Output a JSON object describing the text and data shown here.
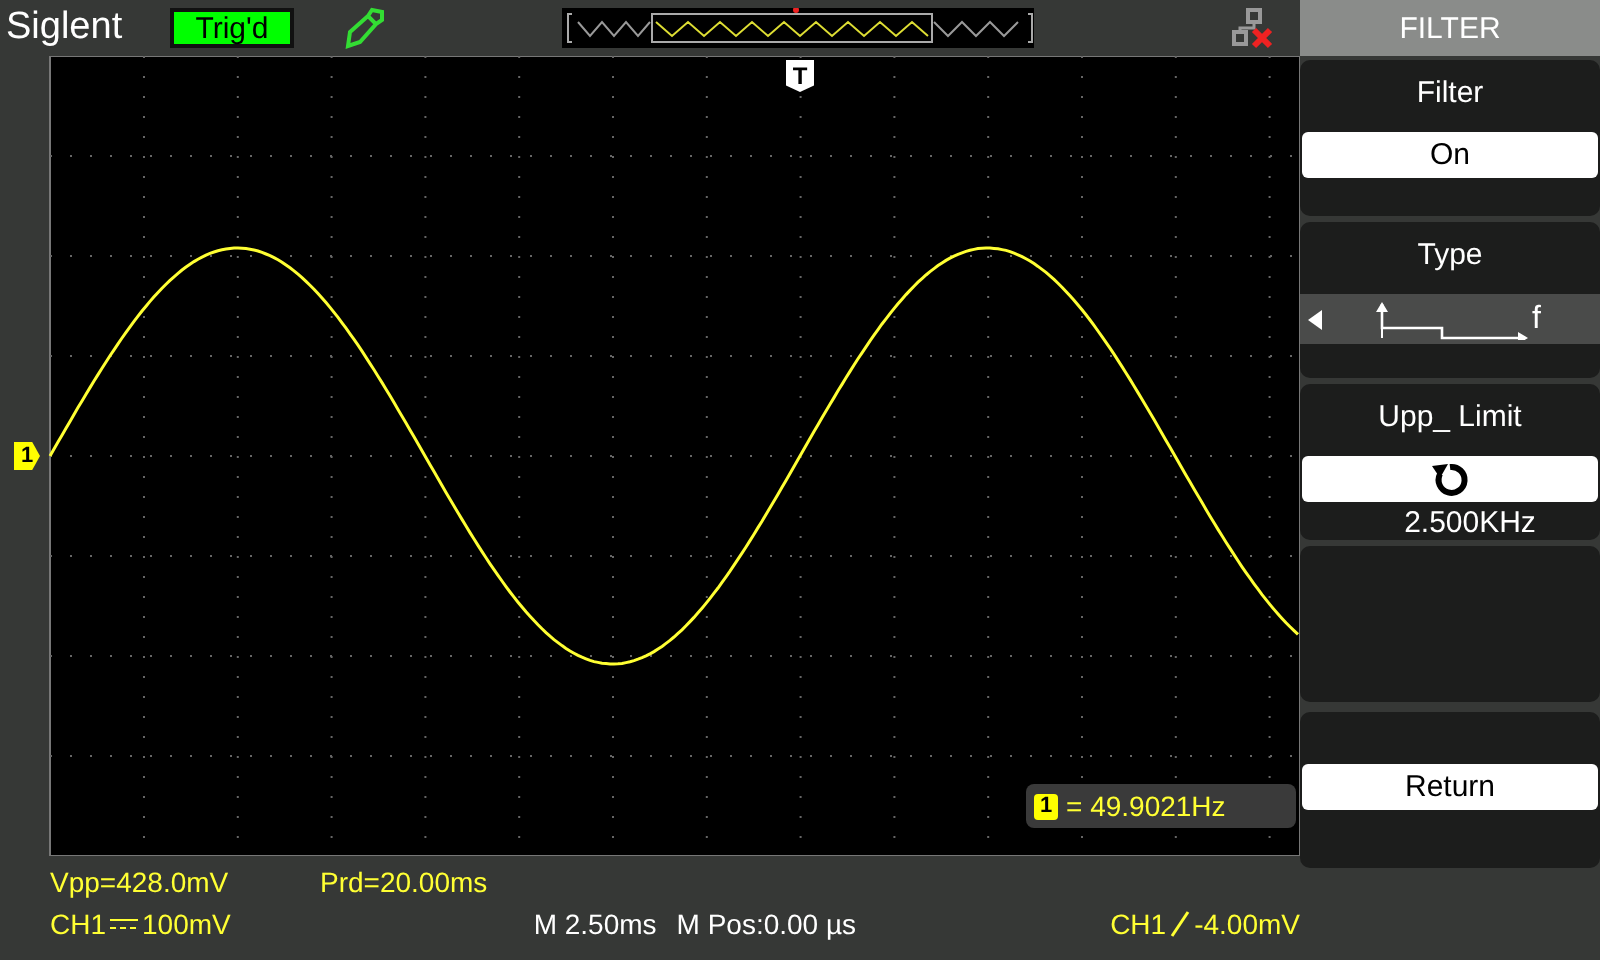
{
  "top_bar": {
    "brand": "Siglent",
    "trigger_status": "Trig'd"
  },
  "screen": {
    "channel_marker": "1",
    "trigger_marker": "T",
    "frequency_readout": {
      "channel": "1",
      "text": "= 49.9021Hz"
    }
  },
  "menu": {
    "title": "FILTER",
    "items": [
      {
        "kind": "toggle",
        "label": "Filter",
        "value": "On"
      },
      {
        "kind": "select",
        "label": "Type",
        "axis_label": "f"
      },
      {
        "kind": "knob",
        "label": "Upp_ Limit",
        "value": "2.500KHz"
      },
      {
        "kind": "empty"
      },
      {
        "kind": "button",
        "label": "Return"
      }
    ]
  },
  "status_bar": {
    "measurements": [
      "Vpp=428.0mV",
      "Prd=20.00ms"
    ],
    "channel": "CH1",
    "volts_per_div": "100mV",
    "timebase": "M 2.50ms",
    "position": "M Pos:0.00 µs",
    "trigger_channel": "CH1",
    "trigger_level": "-4.00mV"
  }
}
